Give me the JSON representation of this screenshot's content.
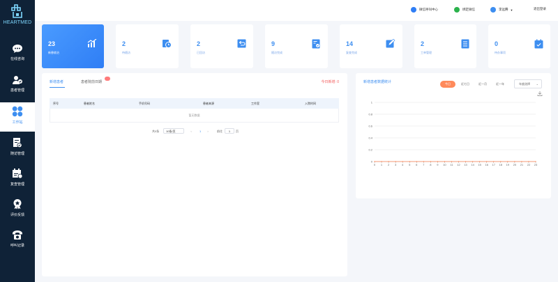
{
  "brand": {
    "logo_text": "HEARTMED",
    "accent": "#3d8ef0"
  },
  "sidebar": {
    "items": [
      {
        "label": "在线咨询",
        "icon": "chat-icon"
      },
      {
        "label": "患者管理",
        "icon": "patient-icon"
      },
      {
        "label": "工作站",
        "icon": "workstation-icon"
      },
      {
        "label": "随访管理",
        "icon": "followup-icon"
      },
      {
        "label": "复查管理",
        "icon": "recheck-icon"
      },
      {
        "label": "评价反馈",
        "icon": "badge-icon"
      },
      {
        "label": "呼叫记录",
        "icon": "phone-icon"
      }
    ]
  },
  "topbar": {
    "service_center": "微信呼叫中心",
    "wechat_link": "绑定微信",
    "user_name": "李远腾",
    "logout": "退出登录"
  },
  "cards": [
    {
      "num": "23",
      "label": "新患收治",
      "icon": "chart-up-icon"
    },
    {
      "num": "2",
      "label": "待随访",
      "icon": "clock-icon"
    },
    {
      "num": "2",
      "label": "已回访",
      "icon": "return-icon"
    },
    {
      "num": "9",
      "label": "随访完成",
      "icon": "doc-check-icon"
    },
    {
      "num": "14",
      "label": "复查完成",
      "icon": "edit-icon"
    },
    {
      "num": "2",
      "label": "工单管理",
      "icon": "list-icon"
    },
    {
      "num": "0",
      "label": "待办事项",
      "icon": "calendar-icon"
    }
  ],
  "table_panel": {
    "tabs": [
      "新增患者",
      "患者院前日期"
    ],
    "red_label": "今日新增: 0",
    "columns": [
      "序号",
      "患者姓名",
      "手机号码",
      "患者来源",
      "工作室",
      "入院时间"
    ],
    "empty_text": "暂无数据",
    "pagination": {
      "total_label": "共0条",
      "page_size": "10条/页",
      "prev": "<",
      "current": "1",
      "next": ">",
      "goto_label": "前往",
      "goto_value": "1",
      "page_unit": "页"
    }
  },
  "chart_panel": {
    "title": "新增患者数据统计",
    "segments": [
      "今日",
      "近七日",
      "近一月",
      "近一年"
    ],
    "year_select": "年度选择"
  },
  "chart_data": {
    "type": "line",
    "x": [
      "0",
      "1",
      "2",
      "3",
      "4",
      "5",
      "6",
      "7",
      "8",
      "9",
      "10",
      "11",
      "12",
      "13",
      "14",
      "15",
      "16",
      "17",
      "18",
      "19",
      "20",
      "21",
      "22",
      "23"
    ],
    "series": [
      {
        "values": [
          0,
          0,
          0,
          0,
          0,
          0,
          0,
          0,
          0,
          0,
          0,
          0,
          0,
          0,
          0,
          0,
          0,
          0,
          0,
          0,
          0,
          0,
          0,
          0
        ],
        "color": "#ff8a5b"
      }
    ],
    "y_ticks": [
      "0",
      "0.2",
      "0.4",
      "0.6",
      "0.8",
      "1"
    ],
    "ylim": [
      0,
      1
    ],
    "grid": true
  }
}
